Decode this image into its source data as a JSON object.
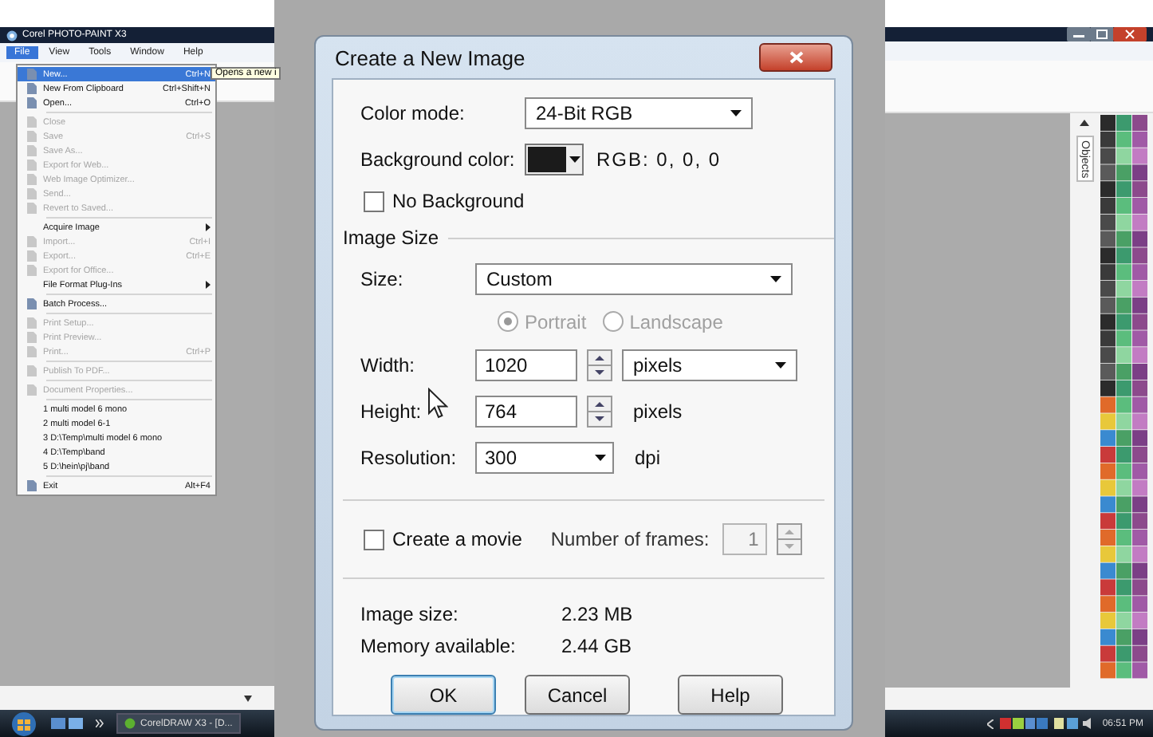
{
  "app_window": {
    "title": "Corel PHOTO-PAINT X3",
    "menu_bar": [
      {
        "label": "File",
        "selected": true
      },
      {
        "label": "View",
        "selected": false
      },
      {
        "label": "Tools",
        "selected": false
      },
      {
        "label": "Window",
        "selected": false
      },
      {
        "label": "Help",
        "selected": false
      }
    ],
    "tooltip": "Opens a new i",
    "docker_tab": "Objects"
  },
  "file_menu": {
    "groups": [
      [
        {
          "label": "New...",
          "shortcut": "Ctrl+N",
          "kind": "command",
          "disabled": false,
          "selected": true
        },
        {
          "label": "New From Clipboard",
          "shortcut": "Ctrl+Shift+N",
          "kind": "command",
          "disabled": false,
          "selected": false
        },
        {
          "label": "Open...",
          "shortcut": "Ctrl+O",
          "kind": "command",
          "disabled": false,
          "selected": false
        }
      ],
      [
        {
          "label": "Close",
          "kind": "command",
          "disabled": true,
          "selected": false
        },
        {
          "label": "Save",
          "shortcut": "Ctrl+S",
          "kind": "command",
          "disabled": true,
          "selected": false
        },
        {
          "label": "Save As...",
          "kind": "command",
          "disabled": true,
          "selected": false
        },
        {
          "label": "Export for Web...",
          "kind": "command",
          "disabled": true,
          "selected": false
        },
        {
          "label": "Web Image Optimizer...",
          "kind": "command",
          "disabled": true,
          "selected": false
        },
        {
          "label": "Send...",
          "kind": "command",
          "disabled": true,
          "selected": false
        },
        {
          "label": "Revert to Saved...",
          "kind": "command",
          "disabled": true,
          "selected": false
        }
      ],
      [
        {
          "label": "Acquire Image",
          "kind": "submenu",
          "disabled": false,
          "selected": false
        },
        {
          "label": "Import...",
          "shortcut": "Ctrl+I",
          "kind": "command",
          "disabled": true,
          "selected": false
        },
        {
          "label": "Export...",
          "shortcut": "Ctrl+E",
          "kind": "command",
          "disabled": true,
          "selected": false
        },
        {
          "label": "Export for Office...",
          "kind": "command",
          "disabled": true,
          "selected": false
        },
        {
          "label": "File Format Plug-Ins",
          "kind": "submenu",
          "disabled": false,
          "selected": false
        }
      ],
      [
        {
          "label": "Batch Process...",
          "kind": "command",
          "disabled": false,
          "selected": false
        }
      ],
      [
        {
          "label": "Print Setup...",
          "kind": "command",
          "disabled": true,
          "selected": false
        },
        {
          "label": "Print Preview...",
          "kind": "command",
          "disabled": true,
          "selected": false
        },
        {
          "label": "Print...",
          "shortcut": "Ctrl+P",
          "kind": "command",
          "disabled": true,
          "selected": false
        }
      ],
      [
        {
          "label": "Publish To PDF...",
          "kind": "command",
          "disabled": true,
          "selected": false
        }
      ],
      [
        {
          "label": "Document Properties...",
          "kind": "command",
          "disabled": true,
          "selected": false
        }
      ],
      [
        {
          "label": "1 multi model 6 mono",
          "kind": "recent",
          "disabled": false,
          "selected": false
        },
        {
          "label": "2 multi model 6-1",
          "kind": "recent",
          "disabled": false,
          "selected": false
        },
        {
          "label": "3 D:\\Temp\\multi model 6 mono",
          "kind": "recent",
          "disabled": false,
          "selected": false
        },
        {
          "label": "4 D:\\Temp\\band",
          "kind": "recent",
          "disabled": false,
          "selected": false
        },
        {
          "label": "5 D:\\hein\\pj\\band",
          "kind": "recent",
          "disabled": false,
          "selected": false
        }
      ],
      [
        {
          "label": "Exit",
          "shortcut": "Alt+F4",
          "kind": "command",
          "disabled": false,
          "selected": false
        }
      ]
    ]
  },
  "dialog": {
    "title": "Create a New Image",
    "color_mode": {
      "label": "Color mode:",
      "value": "24-Bit RGB"
    },
    "background_color": {
      "label": "Background color:",
      "rgb": "RGB:  0,  0,  0"
    },
    "no_background": {
      "label": "No Background",
      "checked": false
    },
    "group_title": "Image Size",
    "size": {
      "label": "Size:",
      "value": "Custom"
    },
    "orientation": [
      {
        "label": "Portrait",
        "selected": true,
        "disabled": true
      },
      {
        "label": "Landscape",
        "selected": false,
        "disabled": true
      }
    ],
    "width": {
      "label": "Width:",
      "value": "1020",
      "unit": "pixels",
      "unit_dropdown": true
    },
    "height": {
      "label": "Height:",
      "value": "764",
      "unit": "pixels",
      "unit_dropdown": false
    },
    "resolution": {
      "label": "Resolution:",
      "value": "300",
      "unit": "dpi"
    },
    "create_movie": {
      "label": "Create a movie",
      "checked": false
    },
    "frames": {
      "label": "Number of frames:",
      "value": "1",
      "disabled": true
    },
    "info": [
      {
        "label": "Image size:",
        "value": "2.23 MB"
      },
      {
        "label": "Memory available:",
        "value": "2.44 GB"
      }
    ],
    "buttons": [
      {
        "label": "OK",
        "default": true
      },
      {
        "label": "Cancel",
        "default": false
      },
      {
        "label": "Help",
        "default": false
      }
    ]
  },
  "taskbar": {
    "task_button": "CorelDRAW X3 - [D...",
    "clock": "06:51 PM"
  }
}
